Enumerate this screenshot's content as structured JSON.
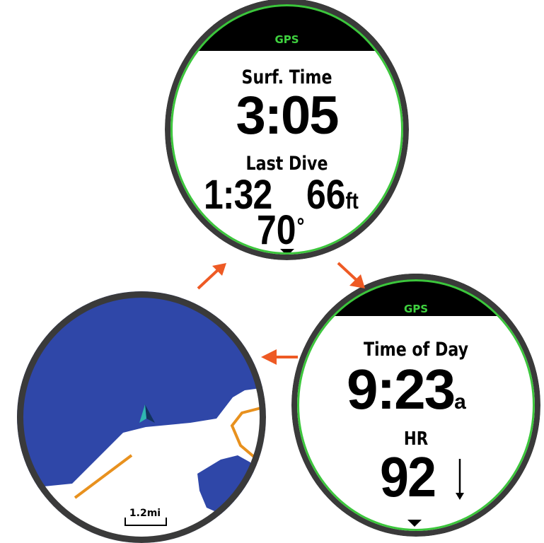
{
  "colors": {
    "gps_text": "#3fd13f",
    "accent_ring": "#3cc63c",
    "bezel": "#3a3a3a",
    "water": "#2f47a8",
    "route": "#e8911e",
    "flow_arrow": "#ee5a24"
  },
  "top_watch": {
    "gps_label": "GPS",
    "surf_time_label": "Surf. Time",
    "surf_time_value": "3:05",
    "last_dive_label": "Last Dive",
    "last_dive_time": "1:32",
    "last_dive_depth": "66",
    "depth_unit": "ft",
    "temperature": "70",
    "temperature_unit": "°"
  },
  "right_watch": {
    "gps_label": "GPS",
    "time_of_day_label": "Time of Day",
    "time_value": "9:23",
    "time_suffix": "a",
    "hr_label": "HR",
    "hr_value": "92",
    "hr_trend_icon": "arrow-down-icon"
  },
  "map_watch": {
    "scale_label": "1.2mi",
    "position_icon": "navigation-arrow-icon"
  },
  "flow_arrows": [
    "arrow-up-right-icon",
    "arrow-down-right-icon",
    "arrow-left-icon"
  ]
}
